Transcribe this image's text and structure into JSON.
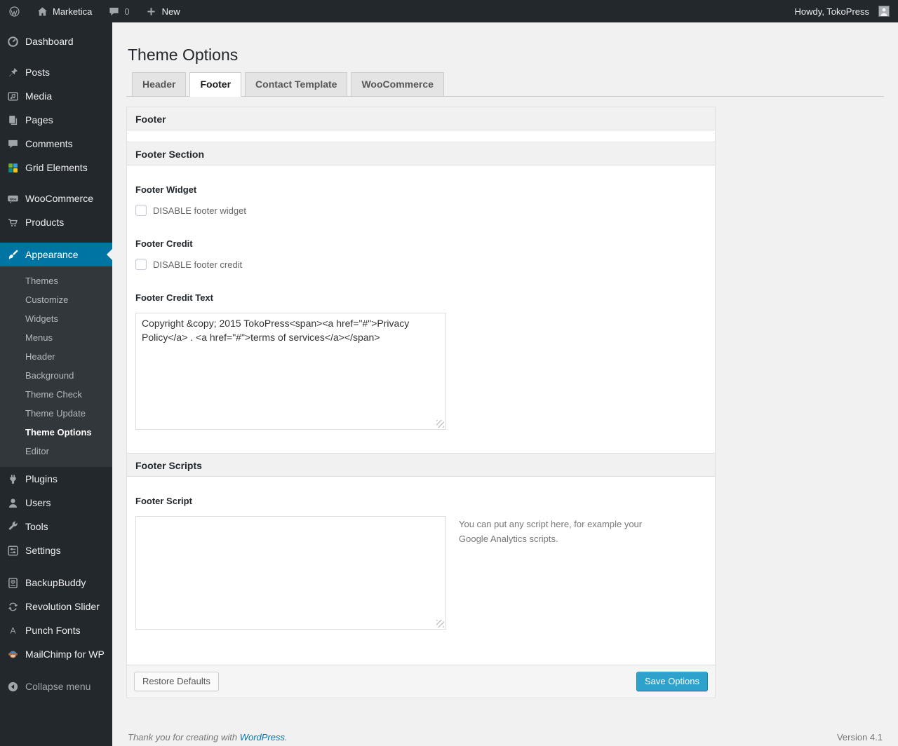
{
  "colors": {
    "accent": "#0074a2",
    "primary_button": "#2ea2cc",
    "admin_bar_bg": "#23282d",
    "submenu_bg": "#32373c"
  },
  "admin_bar": {
    "site_name": "Marketica",
    "comment_count": "0",
    "new_label": "New",
    "howdy": "Howdy, TokoPress"
  },
  "icons": {
    "woo_badge": "Woo",
    "punch_fonts_letter": "A",
    "wp_logo": "wordpress"
  },
  "menu": {
    "items": [
      "Dashboard",
      "Posts",
      "Media",
      "Pages",
      "Comments",
      "Grid Elements",
      "WooCommerce",
      "Products",
      "Appearance",
      "Plugins",
      "Users",
      "Tools",
      "Settings",
      "BackupBuddy",
      "Revolution Slider",
      "Punch Fonts",
      "MailChimp for WP",
      "Collapse menu"
    ],
    "appearance_submenu": [
      "Themes",
      "Customize",
      "Widgets",
      "Menus",
      "Header",
      "Background",
      "Theme Check",
      "Theme Update",
      "Theme Options",
      "Editor"
    ],
    "current_item": "Appearance",
    "current_submenu_item": "Theme Options"
  },
  "page": {
    "title": "Theme Options",
    "tabs": [
      "Header",
      "Footer",
      "Contact Template",
      "WooCommerce"
    ],
    "active_tab": "Footer"
  },
  "content": {
    "box1_title": "Footer",
    "section1_title": "Footer Section",
    "footer_widget": {
      "label": "Footer Widget",
      "checkbox_label": "DISABLE footer widget",
      "checked": false
    },
    "footer_credit": {
      "label": "Footer Credit",
      "checkbox_label": "DISABLE footer credit",
      "checked": false
    },
    "footer_credit_text": {
      "label": "Footer Credit Text",
      "value": "Copyright &copy; 2015 TokoPress<span><a href=\"#\">Privacy Policy</a> . <a href=\"#\">terms of services</a></span>"
    },
    "section2_title": "Footer Scripts",
    "footer_script": {
      "label": "Footer Script",
      "value": "",
      "help": "You can put any script here, for example your Google Analytics scripts."
    }
  },
  "actions": {
    "restore": "Restore Defaults",
    "save": "Save Options"
  },
  "page_footer": {
    "thanks_prefix": "Thank you for creating with ",
    "wordpress_link": "WordPress",
    "thanks_suffix": ".",
    "version": "Version 4.1"
  }
}
